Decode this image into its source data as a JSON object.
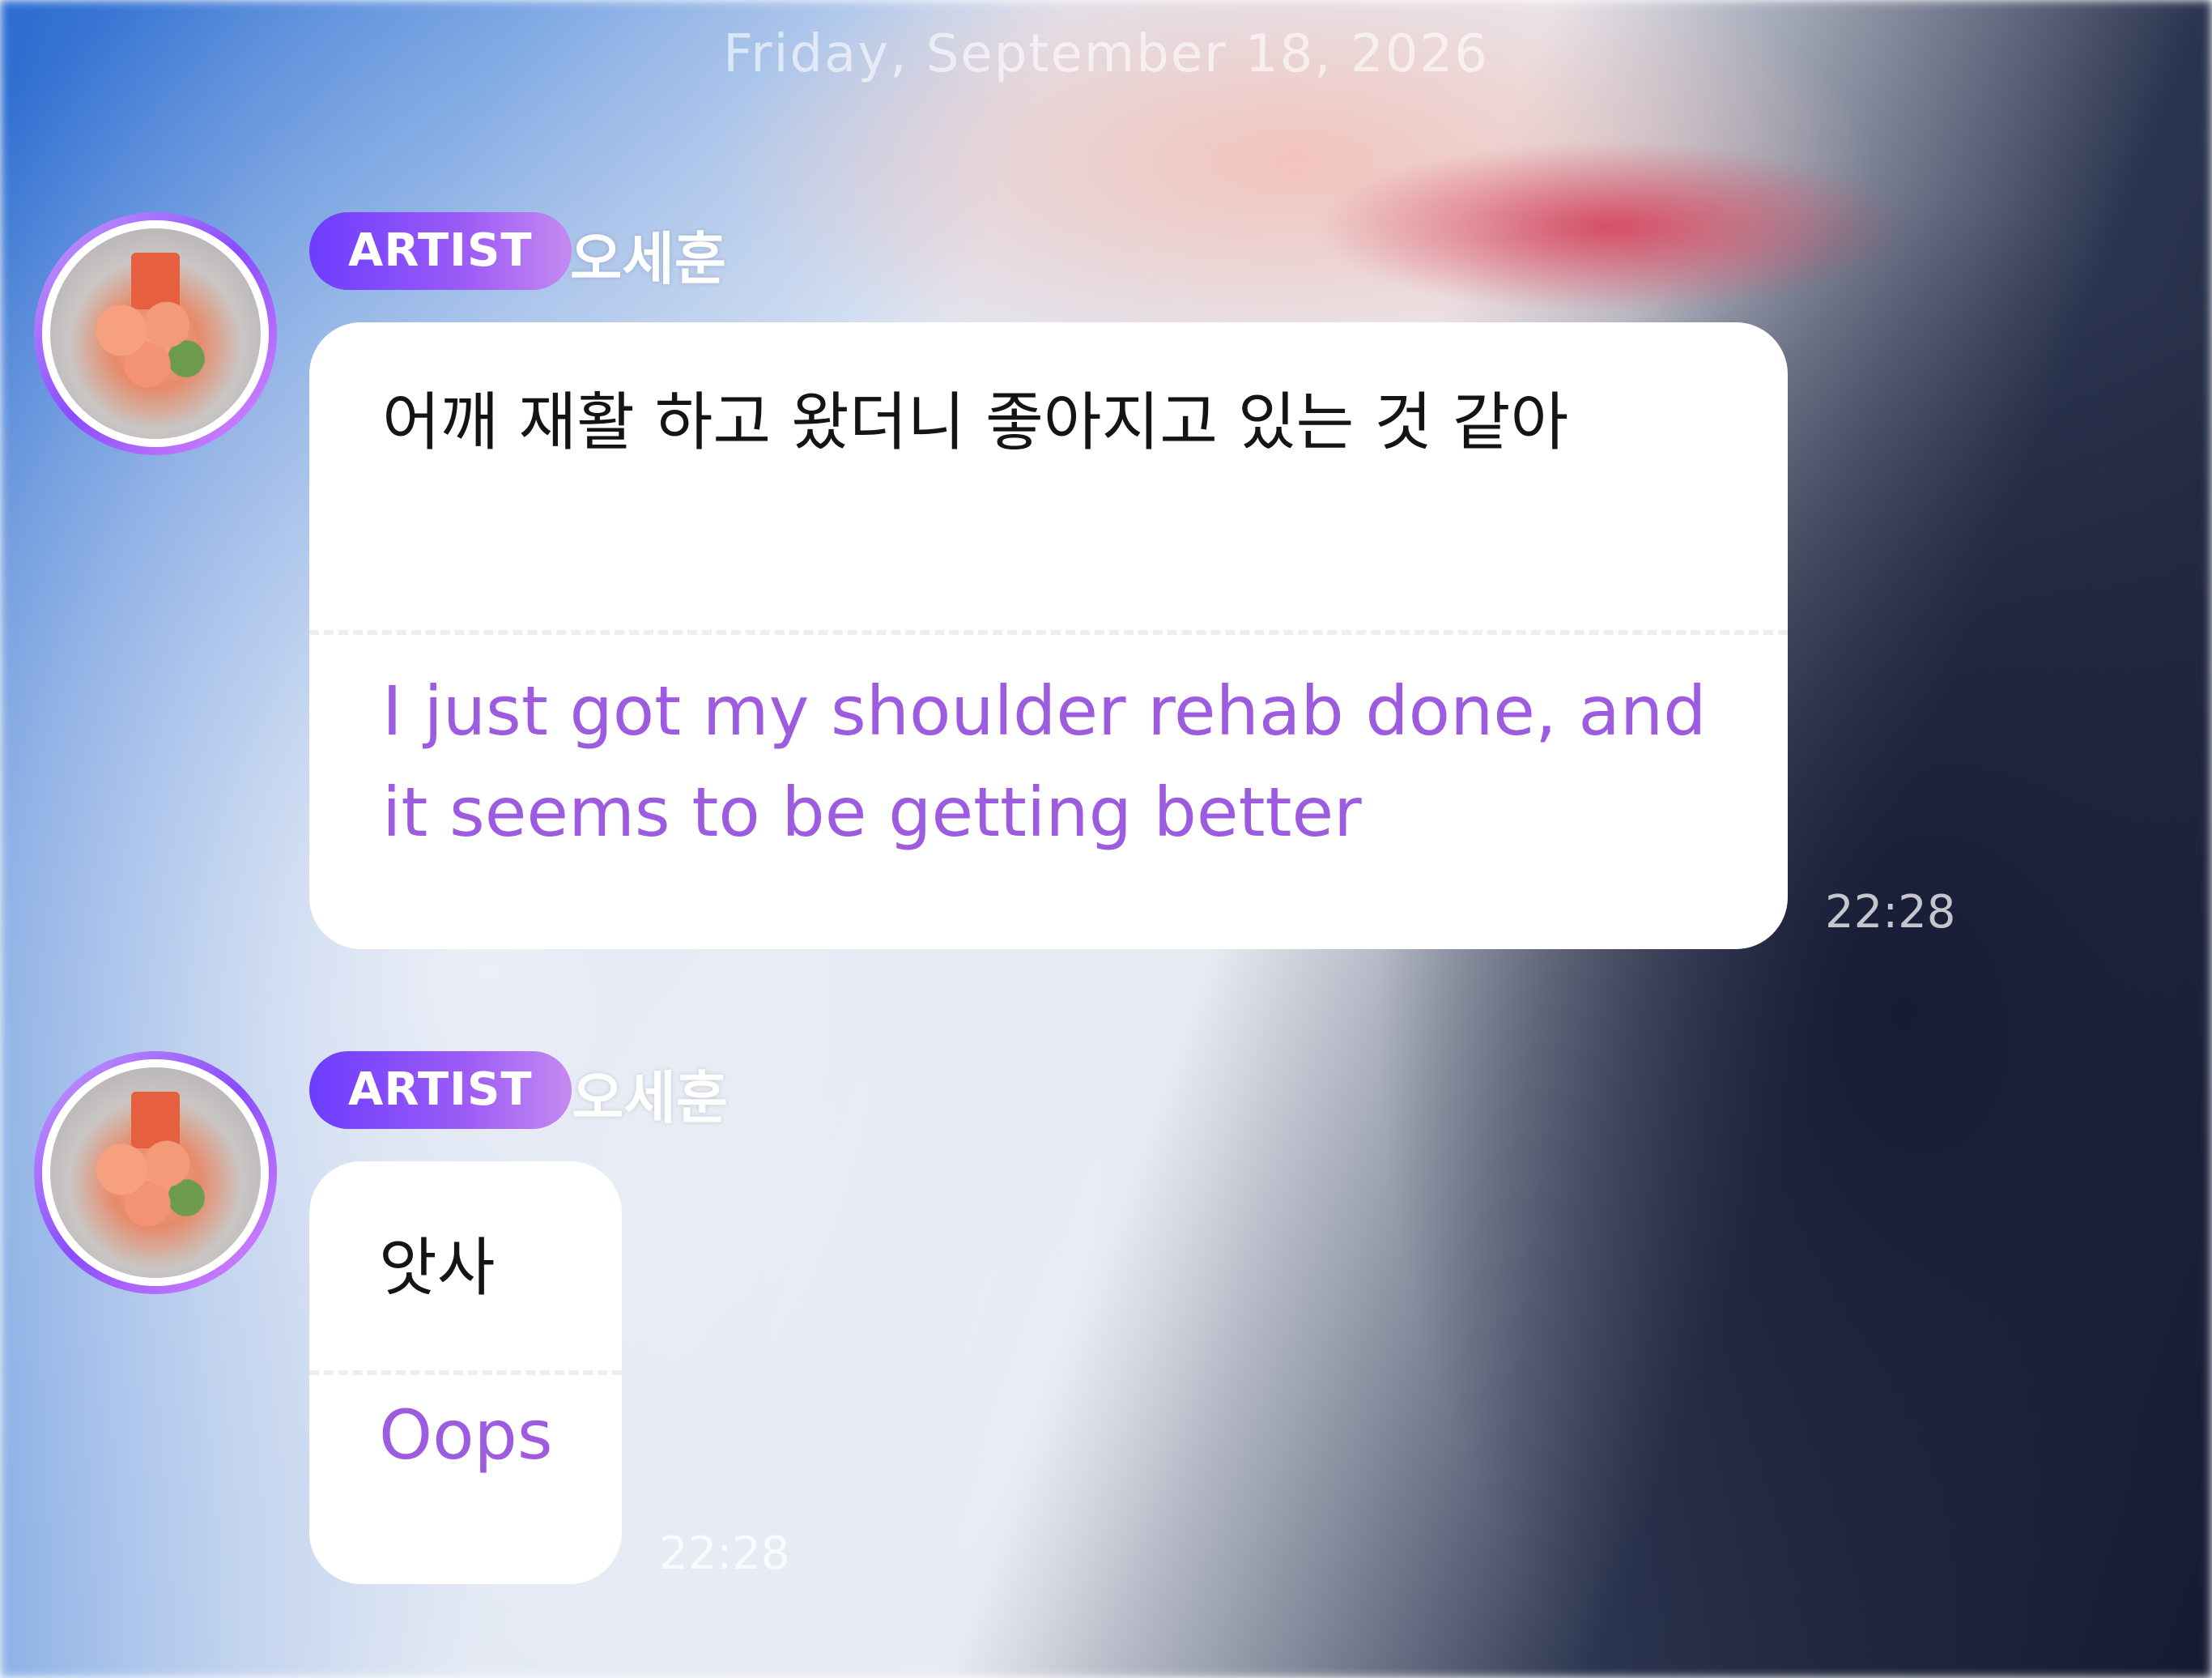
{
  "date_header": "Friday, September 18, 2026",
  "messages": [
    {
      "badge": "ARTIST",
      "sender": "오세훈",
      "text_original": "어깨 재활 하고 왔더니 좋아지고 있는 것 같아",
      "text_translation": "I just got my shoulder rehab done, and it seems to be getting better",
      "time": "22:28"
    },
    {
      "badge": "ARTIST",
      "sender": "오세훈",
      "text_original": "앗사",
      "text_translation": "Oops",
      "time": "22:28"
    }
  ],
  "colors": {
    "badge_start": "#6d3cff",
    "badge_end": "#c58af0",
    "translation_text": "#9d5ce0",
    "bubble": "#ffffff"
  }
}
